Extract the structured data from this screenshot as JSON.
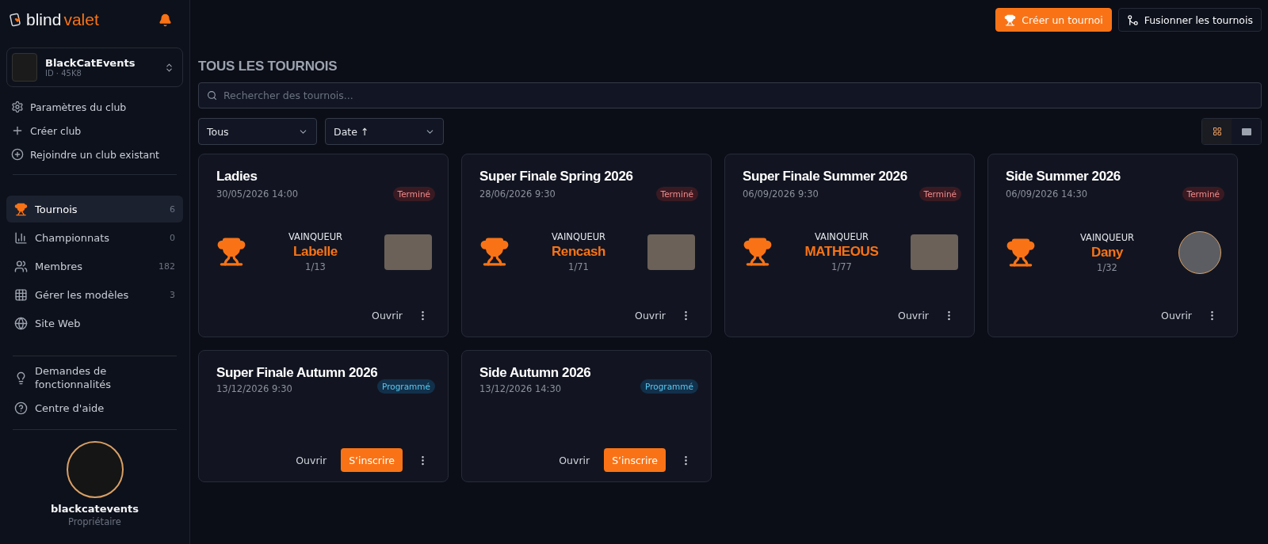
{
  "logo": {
    "first": "blind",
    "second": "valet"
  },
  "club": {
    "name": "BlackCatEvents",
    "id": "ID · 45K8"
  },
  "club_menu": [
    "Paramètres du club",
    "Créer club",
    "Rejoindre un club existant"
  ],
  "nav": [
    {
      "label": "Tournois",
      "count": "6",
      "selected": true
    },
    {
      "label": "Championnats",
      "count": "0",
      "selected": false
    },
    {
      "label": "Membres",
      "count": "182",
      "selected": false
    },
    {
      "label": "Gérer les modèles",
      "count": "3",
      "selected": false
    },
    {
      "label": "Site Web",
      "selected": false
    }
  ],
  "help_links": [
    "Demandes de fonctionnalités",
    "Centre d'aide"
  ],
  "profile": {
    "name": "blackcatevents",
    "role": "Propriétaire"
  },
  "header_buttons": [
    {
      "label": "Créer un tournoi",
      "kind": "primary"
    },
    {
      "label": "Fusionner les tournois",
      "kind": "secondary"
    }
  ],
  "page_title": "TOUS LES TOURNOIS",
  "search": {
    "placeholder": "Rechercher des tournois..."
  },
  "filters": [
    "Tous",
    "Date ↑"
  ],
  "view_toggle": [
    {
      "kind": "grid",
      "selected": true
    },
    {
      "kind": "list",
      "selected": false
    }
  ],
  "tournaments": [
    {
      "title": "Ladies",
      "date": "30/05/2026 14:00",
      "status": {
        "kind": "finished",
        "label": "Terminé"
      },
      "winner": {
        "caption": "VAINQUEUR",
        "name": "Labelle",
        "rank": "1/13",
        "kind": "photo"
      },
      "actions": [
        "Ouvrir"
      ]
    },
    {
      "title": "Super Finale Spring 2026",
      "date": "28/06/2026 9:30",
      "status": {
        "kind": "finished",
        "label": "Terminé"
      },
      "winner": {
        "caption": "VAINQUEUR",
        "name": "Rencash",
        "rank": "1/71",
        "kind": "photo"
      },
      "actions": [
        "Ouvrir"
      ]
    },
    {
      "title": "Super Finale Summer 2026",
      "date": "06/09/2026 9:30",
      "status": {
        "kind": "finished",
        "label": "Terminé"
      },
      "winner": {
        "caption": "VAINQUEUR",
        "name": "MATHEOUS",
        "rank": "1/77",
        "kind": "photo"
      },
      "actions": [
        "Ouvrir"
      ]
    },
    {
      "title": "Side Summer 2026",
      "date": "06/09/2026 14:30",
      "status": {
        "kind": "finished",
        "label": "Terminé"
      },
      "winner": {
        "caption": "VAINQUEUR",
        "name": "Dany",
        "rank": "1/32",
        "kind": "round"
      },
      "actions": [
        "Ouvrir"
      ]
    },
    {
      "title": "Super Finale Autumn 2026",
      "date": "13/12/2026 9:30",
      "status": {
        "kind": "scheduled",
        "label": "Programmé"
      },
      "actions": [
        "Ouvrir",
        "S’inscrire"
      ]
    },
    {
      "title": "Side Autumn 2026",
      "date": "13/12/2026 14:30",
      "status": {
        "kind": "scheduled",
        "label": "Programmé"
      },
      "actions": [
        "Ouvrir",
        "S’inscrire"
      ]
    }
  ]
}
